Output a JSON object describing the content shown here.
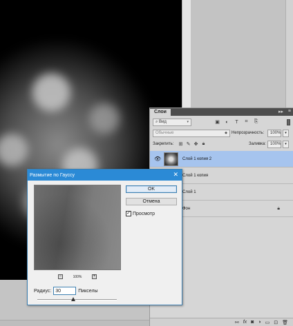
{
  "layers_panel": {
    "tab": "Слои",
    "collapse_icon": "▸▸",
    "menu_icon": "≡",
    "filter": {
      "value": "Вид",
      "icons": [
        "image-icon",
        "adjust-icon",
        "type-icon",
        "shape-icon",
        "smartobject-icon"
      ]
    },
    "blend_mode": "Обычные",
    "opacity_label": "Непрозрачность:",
    "opacity_value": "100%",
    "lock_label": "Закрепить:",
    "fill_label": "Заливка:",
    "fill_value": "100%",
    "layers": [
      {
        "name": "Слой 1 копия 2",
        "selected": true
      },
      {
        "name": "Слой 1 копия",
        "selected": false
      },
      {
        "name": "Слой 1",
        "selected": false
      },
      {
        "name": "Фон",
        "selected": false,
        "locked": true
      }
    ],
    "footer_icons": [
      "link-icon",
      "fx-icon",
      "mask-icon",
      "adjustment-icon",
      "group-icon",
      "new-layer-icon",
      "trash-icon"
    ]
  },
  "dialog": {
    "title": "Размытие по Гауссу",
    "ok_label": "OK",
    "cancel_label": "Отмена",
    "preview_label": "Просмотр",
    "preview_checked": true,
    "zoom_value": "100%",
    "radius_label": "Радиус:",
    "radius_value": "30",
    "radius_unit": "Пикселы",
    "slider_fraction": 0.45
  }
}
